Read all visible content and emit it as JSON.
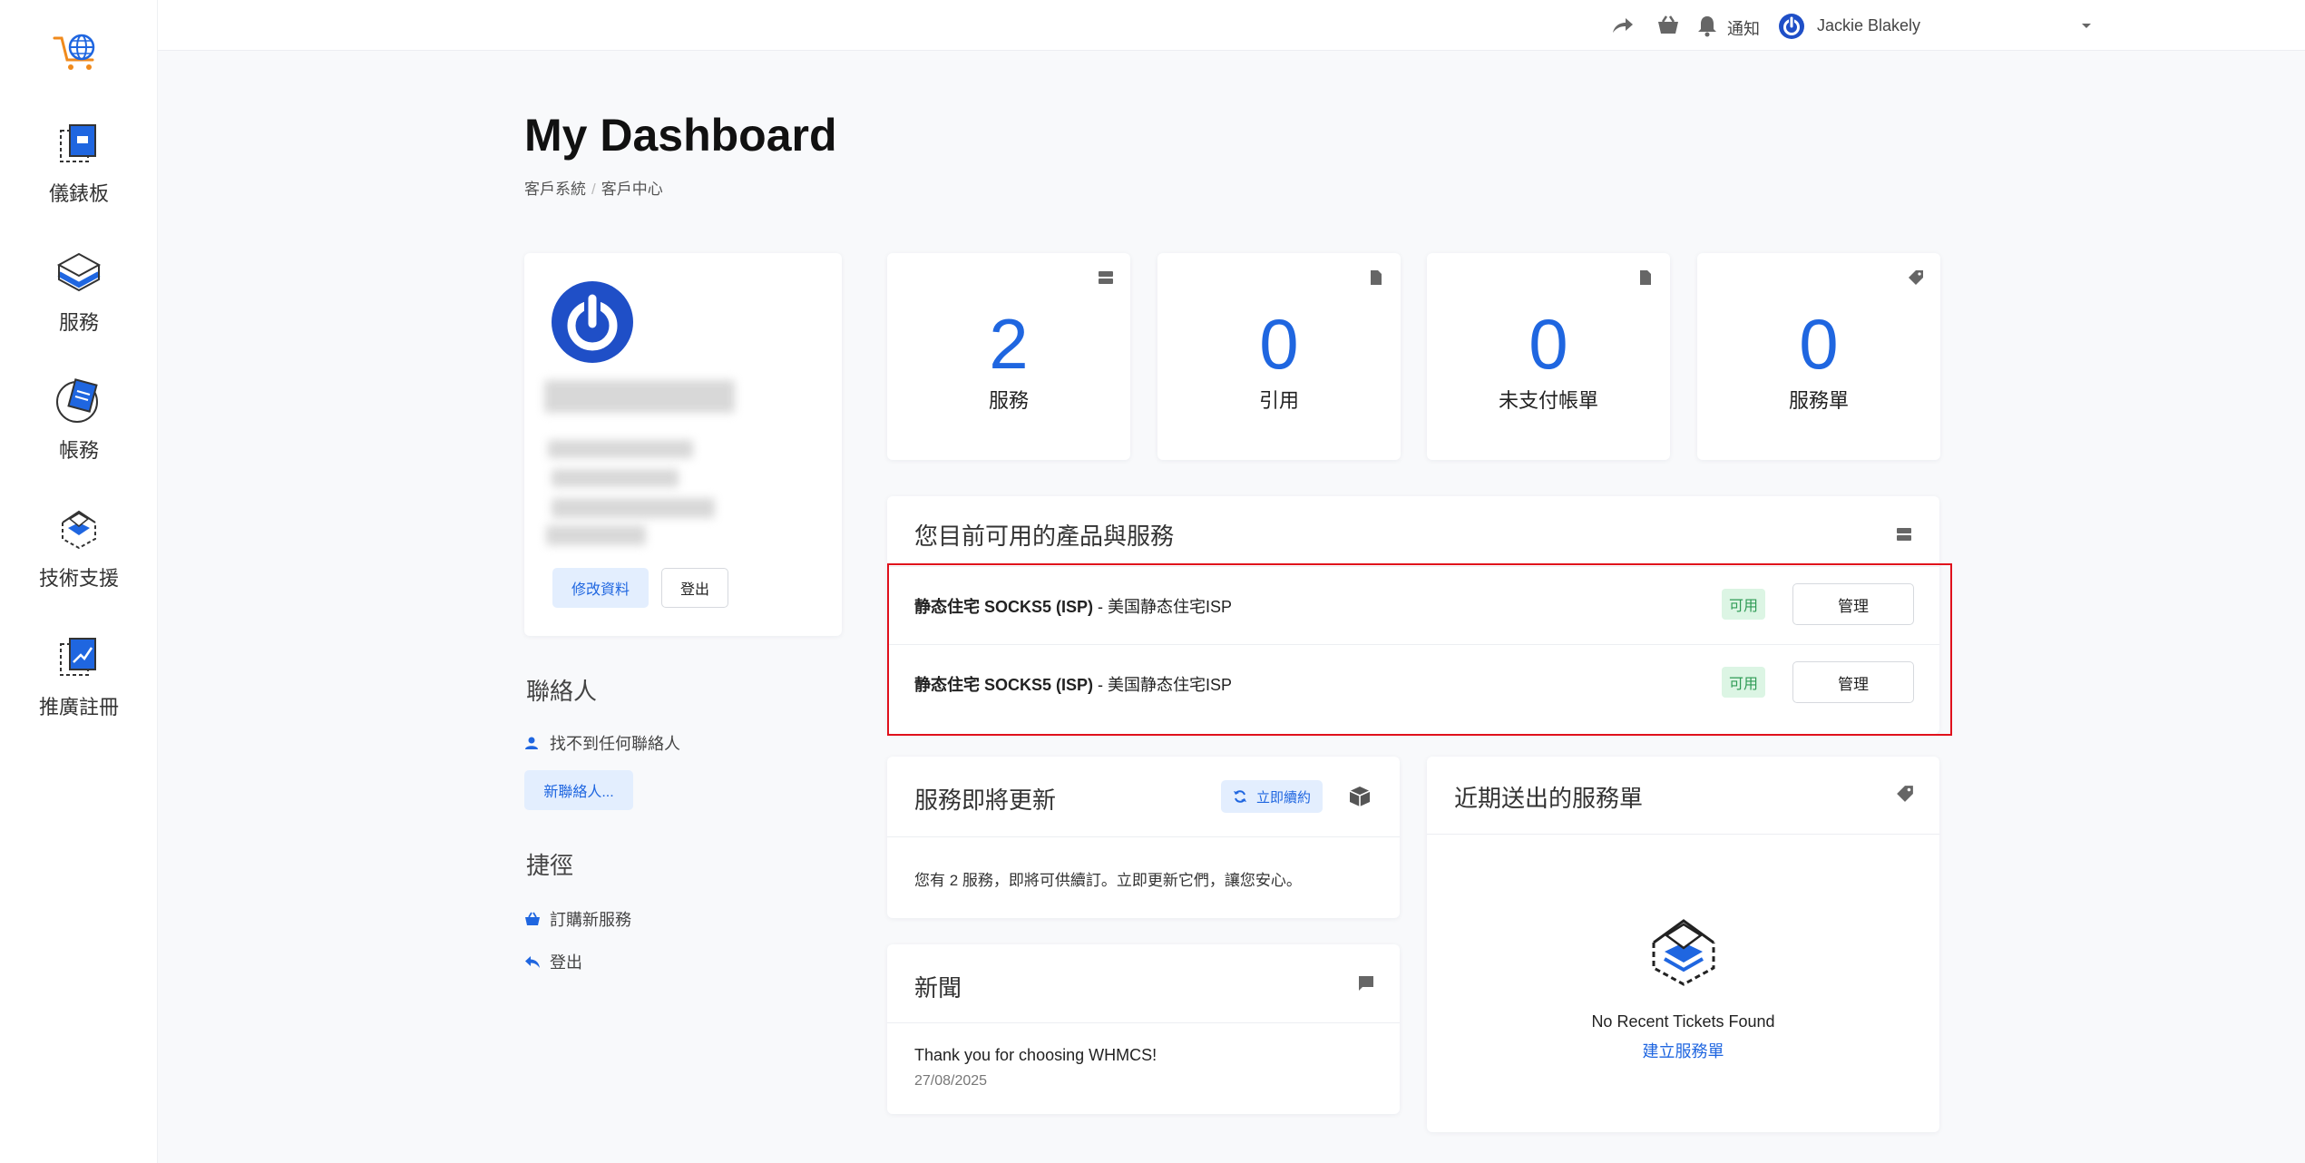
{
  "header": {
    "notifications_label": "通知",
    "user_name": "Jackie Blakely"
  },
  "sidebar": {
    "items": [
      {
        "label": "儀錶板"
      },
      {
        "label": "服務"
      },
      {
        "label": "帳務"
      },
      {
        "label": "技術支援"
      },
      {
        "label": "推廣註冊"
      }
    ]
  },
  "page": {
    "title": "My Dashboard",
    "breadcrumb": [
      "客戶系統",
      "客戶中心"
    ]
  },
  "profile": {
    "edit_button": "修改資料",
    "logout_button": "登出"
  },
  "contacts": {
    "heading": "聯絡人",
    "empty_text": "找不到任何聯絡人",
    "new_button": "新聯絡人..."
  },
  "shortcuts": {
    "heading": "捷徑",
    "order_link": "訂購新服務",
    "logout_link": "登出"
  },
  "stats": [
    {
      "value": "2",
      "label": "服務"
    },
    {
      "value": "0",
      "label": "引用"
    },
    {
      "value": "0",
      "label": "未支付帳單"
    },
    {
      "value": "0",
      "label": "服務單"
    }
  ],
  "products": {
    "title": "您目前可用的產品與服務",
    "rows": [
      {
        "name_bold": "静态住宅 SOCKS5 (ISP)",
        "name_rest": " - 美国静态住宅ISP",
        "status": "可用",
        "action": "管理"
      },
      {
        "name_bold": "静态住宅 SOCKS5 (ISP)",
        "name_rest": " - 美国静态住宅ISP",
        "status": "可用",
        "action": "管理"
      }
    ]
  },
  "renewals": {
    "title": "服務即將更新",
    "renew_button": "立即續約",
    "text": "您有 2 服務，即將可供續訂。立即更新它們，讓您安心。"
  },
  "news": {
    "title": "新聞",
    "item_title": "Thank you for choosing WHMCS!",
    "item_date": "27/08/2025"
  },
  "tickets": {
    "title": "近期送出的服務單",
    "empty_text": "No Recent Tickets Found",
    "create_link": "建立服務單"
  },
  "colors": {
    "accent": "#1f66e0",
    "status_green": "#2e9b55",
    "highlight_red": "#e0111c"
  }
}
